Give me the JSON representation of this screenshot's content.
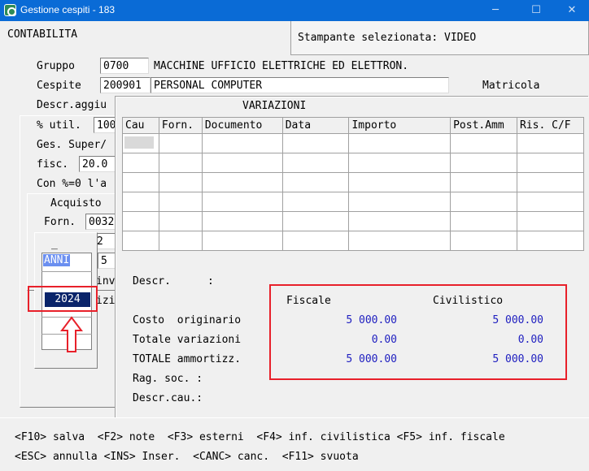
{
  "window": {
    "title": "Gestione cespiti - 183",
    "minimize": "─",
    "maximize": "☐",
    "close": "✕"
  },
  "header": {
    "section": "CONTABILITA",
    "printer_label": "Stampante selezionata: VIDEO"
  },
  "form": {
    "gruppo_label": "Gruppo",
    "gruppo_code": "0700",
    "gruppo_desc": "MACCHINE UFFICIO ELETTRICHE ED ELETTRON.",
    "cespite_label": "Cespite",
    "cespite_code": "200901",
    "cespite_desc": "PERSONAL COMPUTER",
    "matricola_label": "Matricola",
    "descr_agg_label": "Descr.aggiu",
    "util_label": "% util.",
    "util_value": "100",
    "ges_super_label": "Ges. Super/",
    "fisc_label": "fisc.",
    "fisc_value": "20.0",
    "con_label": "Con %=0 l'a",
    "acquisto_label": "Acquisto",
    "forn_label": "Forn.",
    "forn_value": "0032",
    "row2_value": "2",
    "row3_value": "5",
    "partial_inv": "inv",
    "partial_izi": "izi"
  },
  "variazioni": {
    "title": "VARIAZIONI",
    "columns": [
      "Cau",
      "Forn.",
      "Documento",
      "Data",
      "Importo",
      "Post.Amm",
      "Ris. C/F"
    ],
    "rows": [
      [
        "",
        "",
        "",
        "",
        "",
        "",
        ""
      ],
      [
        "",
        "",
        "",
        "",
        "",
        "",
        ""
      ],
      [
        "",
        "",
        "",
        "",
        "",
        "",
        ""
      ],
      [
        "",
        "",
        "",
        "",
        "",
        "",
        ""
      ],
      [
        "",
        "",
        "",
        "",
        "",
        "",
        ""
      ],
      [
        "",
        "",
        "",
        "",
        "",
        "",
        ""
      ]
    ],
    "descr_label": "Descr.",
    "descr_colon": ":",
    "fiscale_header": "Fiscale",
    "civilistico_header": "Civilistico",
    "costo_label": "Costo  originario",
    "costo_fiscale": "5 000.00",
    "costo_civilistico": "5 000.00",
    "totvar_label": "Totale variazioni",
    "totvar_fiscale": "0.00",
    "totvar_civilistico": "0.00",
    "totamm_label": "TOTALE ammortizz.",
    "totamm_fiscale": "5 000.00",
    "totamm_civilistico": "5 000.00",
    "ragsoc_label": "Rag. soc. :",
    "descrcau_label": "Descr.cau.:"
  },
  "anni_popup": {
    "dash": "_",
    "header": "ANNI",
    "selected_year": "2024"
  },
  "footer": {
    "line1": "<F10> salva  <F2> note  <F3> esterni  <F4> inf. civilistica <F5> inf. fiscale",
    "line2": "<ESC> annulla <INS> Inser.  <CANC> canc.  <F11> svuota"
  },
  "colors": {
    "titlebar": "#0a6bd6",
    "annotation_red": "#e8202a",
    "value_blue": "#2020c0",
    "selection_blue": "#0a246a"
  }
}
